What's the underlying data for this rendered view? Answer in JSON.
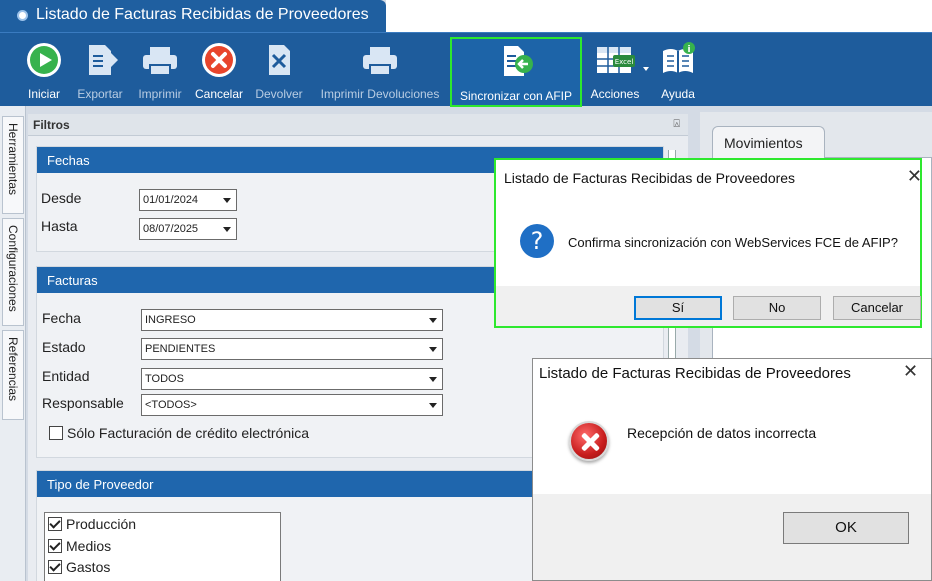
{
  "app": {
    "window_title": "Listado de Facturas Recibidas de Proveedores"
  },
  "toolbar": {
    "items": [
      {
        "label": "Iniciar",
        "icon": "play-icon",
        "enabled": true
      },
      {
        "label": "Exportar",
        "icon": "export-icon",
        "enabled": false
      },
      {
        "label": "Imprimir",
        "icon": "printer-icon",
        "enabled": false
      },
      {
        "label": "Cancelar",
        "icon": "cancel-icon",
        "enabled": true
      },
      {
        "label": "Devolver",
        "icon": "return-icon",
        "enabled": false
      },
      {
        "label": "Imprimir Devoluciones",
        "icon": "printer-icon",
        "enabled": false
      },
      {
        "label": "Sincronizar con AFIP",
        "icon": "sync-document-icon",
        "enabled": true,
        "highlighted": true
      },
      {
        "label": "Acciones",
        "icon": "excel-icon",
        "enabled": true
      },
      {
        "label": "Ayuda",
        "icon": "help-book-icon",
        "enabled": true
      }
    ],
    "excel_badge": "Excel"
  },
  "side_tabs": [
    "Herramientas",
    "Configuraciones",
    "Referencias"
  ],
  "filters": {
    "panel_title": "Filtros",
    "pin_glyph": "⍓",
    "fechas": {
      "title": "Fechas",
      "desde_label": "Desde",
      "desde_value": "01/01/2024",
      "hasta_label": "Hasta",
      "hasta_value": "08/07/2025"
    },
    "facturas": {
      "title": "Facturas",
      "fecha_label": "Fecha",
      "fecha_value": "INGRESO",
      "estado_label": "Estado",
      "estado_value": "PENDIENTES",
      "entidad_label": "Entidad",
      "entidad_value": "TODOS",
      "responsable_label": "Responsable",
      "responsable_value": "<TODOS>",
      "checkbox_label": "Sólo Facturación de crédito electrónica",
      "checkbox_checked": false
    },
    "tipo_proveedor": {
      "title": "Tipo de Proveedor",
      "items": [
        {
          "label": "Producción",
          "checked": true
        },
        {
          "label": "Medios",
          "checked": true
        },
        {
          "label": "Gastos",
          "checked": true
        }
      ]
    }
  },
  "movimientos": {
    "tab_label": "Movimientos"
  },
  "confirm_dialog": {
    "title": "Listado de Facturas Recibidas de Proveedores",
    "icon": "question-icon",
    "icon_glyph": "?",
    "message": "Confirma sincronización con WebServices FCE de AFIP?",
    "buttons": {
      "yes": "Sí",
      "no": "No",
      "cancel": "Cancelar"
    },
    "close_glyph": "✕"
  },
  "error_dialog": {
    "title": "Listado de Facturas Recibidas de Proveedores",
    "icon": "error-icon",
    "message": "Recepción de datos incorrecta",
    "ok_label": "OK",
    "close_glyph": "✕"
  }
}
